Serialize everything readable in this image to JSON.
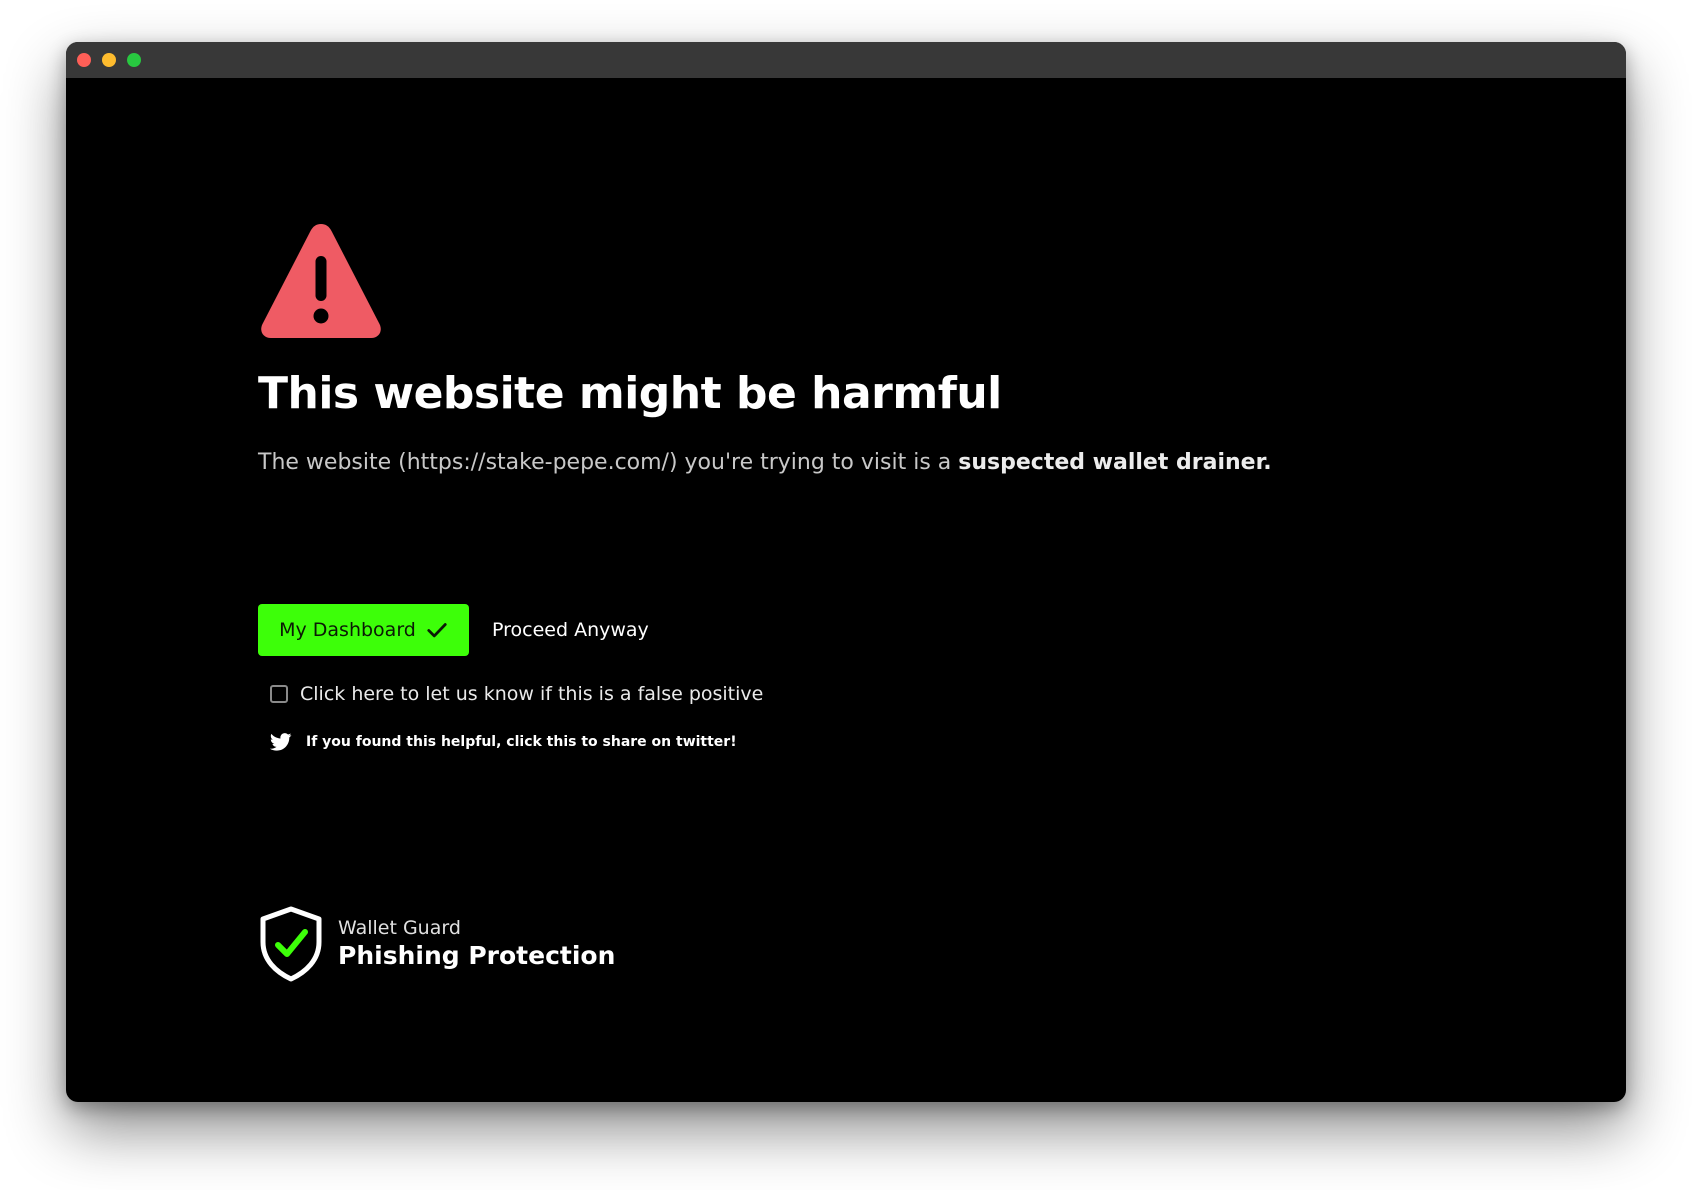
{
  "window": {
    "controls": [
      "close",
      "minimize",
      "maximize"
    ]
  },
  "warning": {
    "icon": "warning-triangle-icon",
    "title": "This website might be harmful",
    "description_prefix": "The website (https://stake-pepe.com/) you're trying to visit is a ",
    "description_emphasis": "suspected wallet drainer."
  },
  "actions": {
    "dashboard_label": "My Dashboard",
    "dashboard_icon": "checkmark-icon",
    "proceed_label": "Proceed Anyway"
  },
  "feedback": {
    "false_positive_label": "Click here to let us know if this is a false positive",
    "false_positive_checked": false
  },
  "share": {
    "icon": "twitter-icon",
    "label": "If you found this helpful, click this to share on twitter!"
  },
  "brand": {
    "icon": "shield-check-icon",
    "name": "Wallet Guard",
    "product": "Phishing Protection"
  },
  "colors": {
    "background": "#000000",
    "accent_green": "#3dff09",
    "warning_red": "#ef5b64",
    "titlebar": "#383838"
  }
}
